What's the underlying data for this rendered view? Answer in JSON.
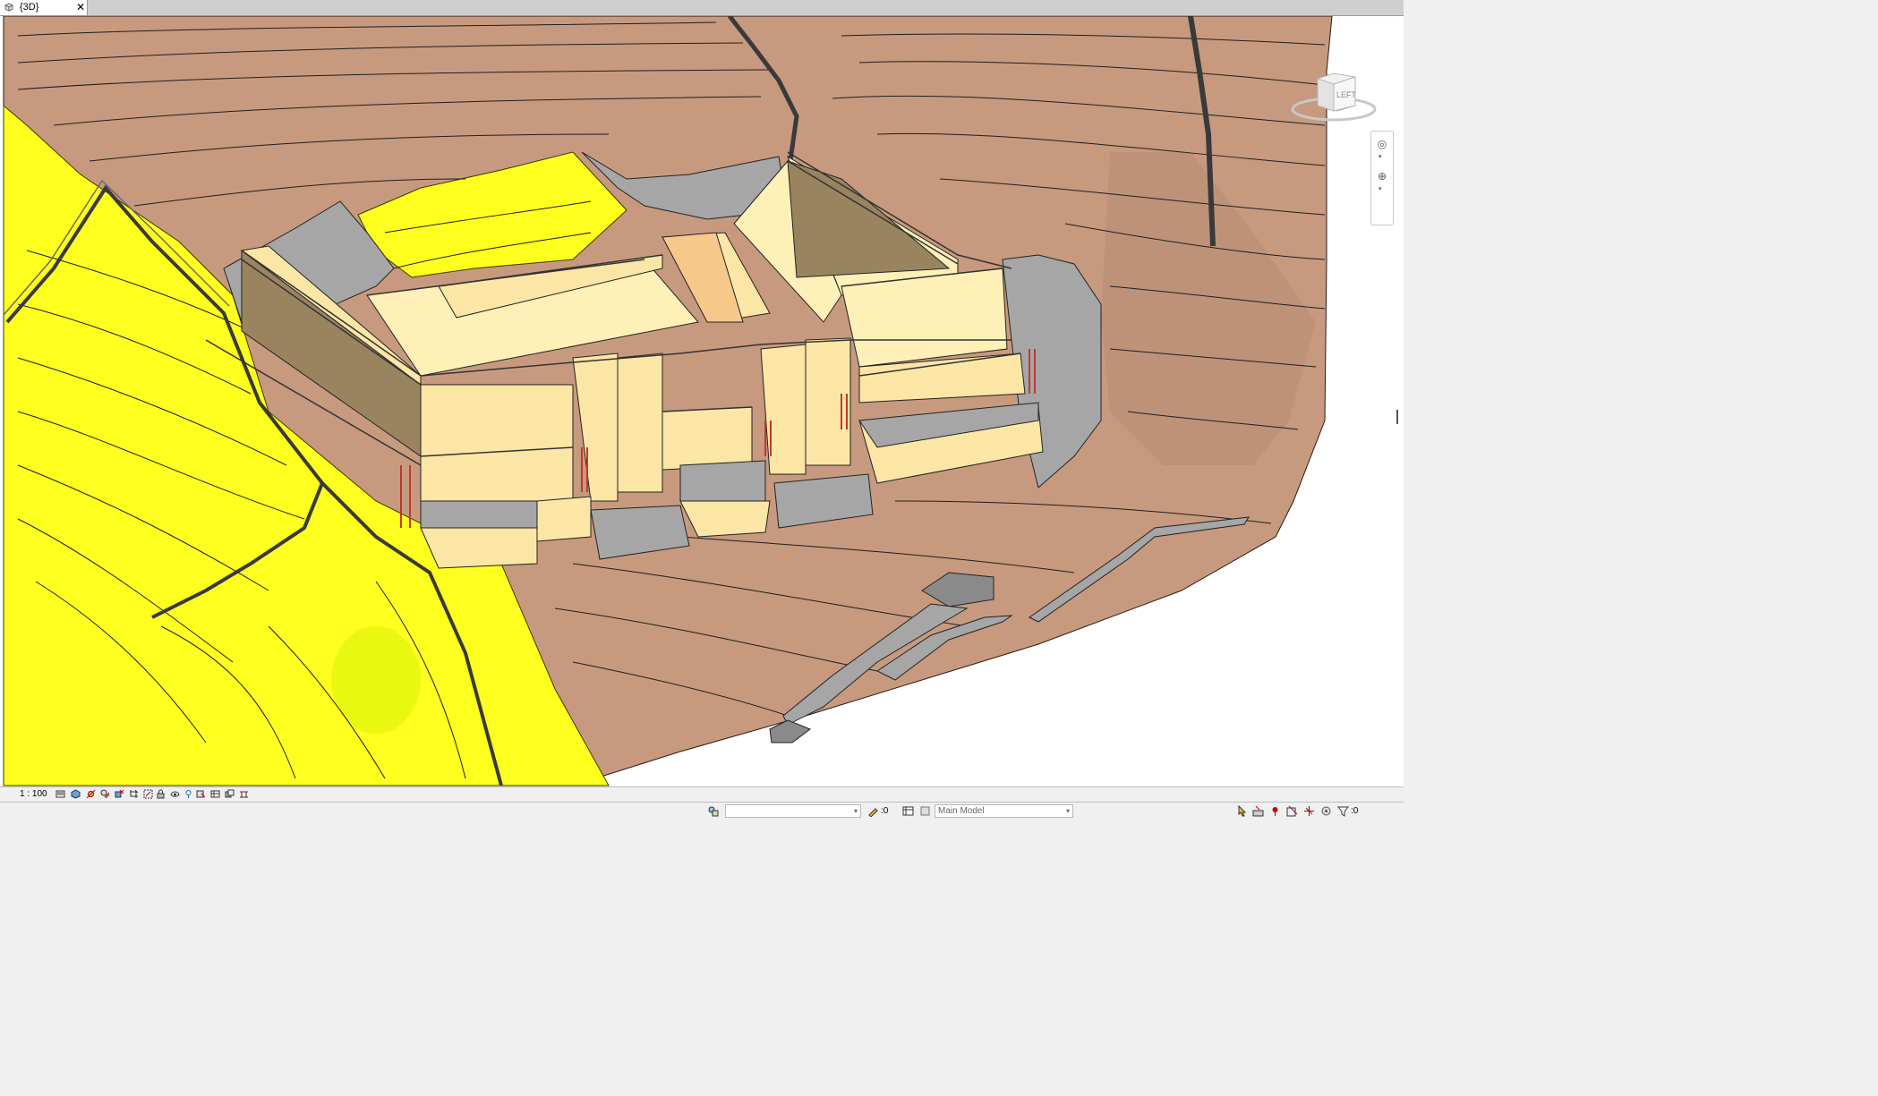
{
  "view_tab": {
    "title": "{3D}",
    "close_glyph": "✕"
  },
  "viewcube": {
    "face_label": "LEFT"
  },
  "view_control_bar": {
    "scale": "1 : 100"
  },
  "status_bar": {
    "workset_value": "",
    "editable_count": ":0",
    "design_option": "Main Model",
    "filter_count": ":0"
  },
  "colors": {
    "terrain": "#c79a7f",
    "topsoil": "#ffff1f",
    "structure_top": "#fff0b8",
    "structure_face": "#fbe6a6",
    "structure_shadow": "#9a8460",
    "concrete": "#a6a6a6",
    "railing": "#3a3a3a",
    "selection_red": "#c0392b"
  }
}
